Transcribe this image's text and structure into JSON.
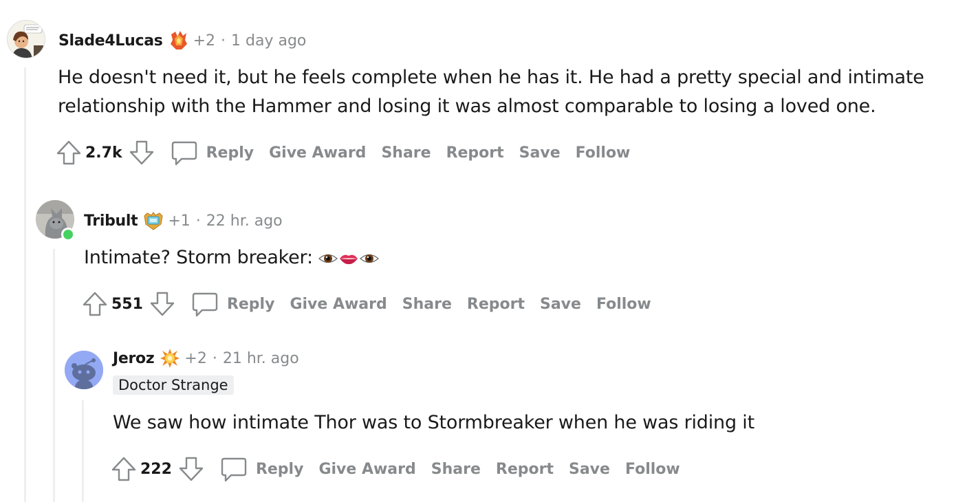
{
  "comments": [
    {
      "username": "Slade4Lucas",
      "award_count": "+2",
      "separator": "·",
      "time": "1 day ago",
      "body_line1": "He doesn't need it, but he feels complete when he has it. He had a pretty special and intimate",
      "body_line2": "relationship with the Hammer and losing it was almost comparable to losing a loved one.",
      "score": "2.7k",
      "avatar_icon": "custom-avatar",
      "award_icon": "fire-crystal-award-icon"
    },
    {
      "username": "Tribult",
      "award_count": "+1",
      "separator": "·",
      "time": "22 hr. ago",
      "body": "Intimate? Storm breaker: ",
      "emojis": [
        "eye",
        "lips",
        "eye"
      ],
      "score": "551",
      "online": true,
      "avatar_icon": "cat-avatar",
      "award_icon": "shield-award-icon"
    },
    {
      "username": "Jeroz",
      "award_count": "+2",
      "separator": "·",
      "time": "21 hr. ago",
      "flair": "Doctor Strange",
      "body": "We saw how intimate Thor was to Stormbreaker when he was riding it",
      "score": "222",
      "avatar_icon": "snoo-default-avatar",
      "award_icon": "explosion-award-icon"
    }
  ],
  "actions": {
    "reply": "Reply",
    "give_award": "Give Award",
    "share": "Share",
    "report": "Report",
    "save": "Save",
    "follow": "Follow"
  },
  "colors": {
    "meta_gray": "#878a8c",
    "thread_line": "#edeff1",
    "online": "#46d160",
    "snoo_bg": "#94a9f4"
  }
}
